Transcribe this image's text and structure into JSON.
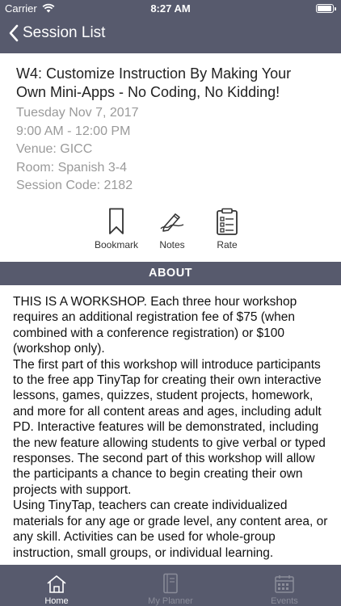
{
  "status_bar": {
    "carrier": "Carrier",
    "time": "8:27 AM",
    "battery_level": 0.95
  },
  "nav": {
    "back_label": "Session List"
  },
  "session": {
    "title": "W4: Customize Instruction By Making Your Own Mini-Apps - No Coding, No Kidding!",
    "date": "Tuesday Nov 7, 2017",
    "time": "9:00 AM - 12:00 PM",
    "venue": "Venue: GICC",
    "room": "Room: Spanish 3-4",
    "code": "Session Code: 2182"
  },
  "actions": {
    "bookmark": "Bookmark",
    "notes": "Notes",
    "rate": "Rate"
  },
  "about": {
    "heading": "ABOUT",
    "paragraphs": [
      "THIS IS A WORKSHOP. Each three hour workshop requires an additional registration fee of $75 (when combined with a conference registration) or $100 (workshop only).",
      "The first part of this workshop will introduce participants to the free app TinyTap for creating their own interactive lessons, games, quizzes, student projects, homework, and more for all content areas and ages, including adult PD. Interactive features will be demonstrated, including the new feature allowing students to give verbal or typed responses. The second part of this workshop will allow the participants a chance to begin creating their own projects with support.",
      "Using TinyTap, teachers can create individualized materials for any age or grade level, any content area, or any skill. Activities can be used for whole-group instruction, small groups, or individual learning."
    ]
  },
  "tabs": [
    {
      "label": "Home",
      "icon": "home-icon",
      "active": true
    },
    {
      "label": "My Planner",
      "icon": "planner-icon",
      "active": false
    },
    {
      "label": "Events",
      "icon": "calendar-icon",
      "active": false
    }
  ],
  "colors": {
    "bar": "#575a6d",
    "meta_text": "#9a9a9a",
    "inactive_tab": "#8a8c99"
  }
}
